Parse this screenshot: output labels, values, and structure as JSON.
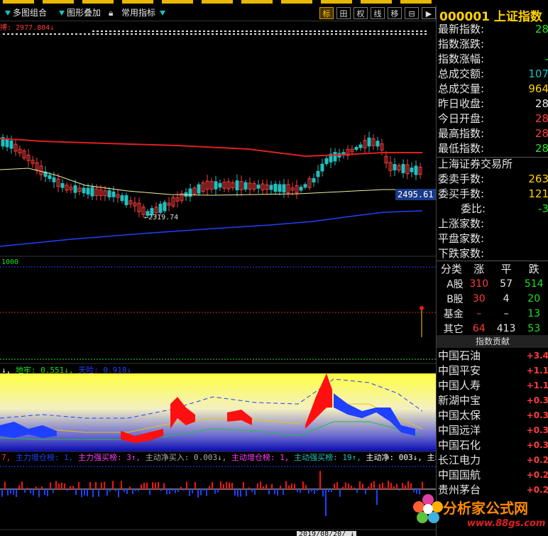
{
  "toolbar": {
    "multi_chart": "多图组合",
    "overlay": "图形叠加",
    "common_indicators": "常用指标",
    "icons": [
      {
        "label": "标",
        "name": "mark-icon",
        "active": true
      },
      {
        "label": "田",
        "name": "grid-icon",
        "active": false
      },
      {
        "label": "权",
        "name": "weight-icon",
        "active": false
      },
      {
        "label": "线",
        "name": "line-icon",
        "active": false
      },
      {
        "label": "移",
        "name": "move-icon",
        "active": false
      },
      {
        "label": "⊟",
        "name": "window-icon",
        "active": false
      },
      {
        "label": "▶",
        "name": "next-icon",
        "active": false
      }
    ]
  },
  "main_chart": {
    "top_label": "搏: 2977.804↓",
    "current_price_tag": "2495.61",
    "low_label": "←2319.74",
    "colors": {
      "ma_long": "#e02020",
      "ma_mid": "#f0f0a0",
      "ma_slow": "#2040ff",
      "up": "#ff3b3b",
      "down": "#21c0c0"
    }
  },
  "vol_panel": {
    "label": "1000"
  },
  "indicator_panel": {
    "labels": [
      {
        "text": "↓,",
        "color": "#ffffff"
      },
      {
        "text": "地牢: 0.551↓,",
        "color": "#21e021"
      },
      {
        "text": "天险: 0.918↓",
        "color": "#2040ff"
      }
    ]
  },
  "flow_panel": {
    "labels": [
      {
        "text": "7,",
        "color": "#ff3b3b"
      },
      {
        "text": "主力增仓榜: 1,",
        "color": "#2040ff"
      },
      {
        "text": "主力强买榜: 3↑,",
        "color": "#ff3bff"
      },
      {
        "text": "主动净买入: 0.003↓,",
        "color": "#aaaaaa"
      },
      {
        "text": "主动增仓榜: 1,",
        "color": "#ff3bff"
      },
      {
        "text": "主动强买榜: 19↑,",
        "color": "#21c0c0"
      },
      {
        "text": "主动净: 003↓,",
        "color": "#ffffff"
      },
      {
        "text": "主动",
        "color": "#ffffff"
      }
    ],
    "bottom_label": "2019/08/20/ ↓"
  },
  "right_panel": {
    "code": "000001",
    "name": "上证指数",
    "quote_rows": [
      {
        "label": "最新指数:",
        "value": "28",
        "color": "#21e021"
      },
      {
        "label": "指数涨跌:",
        "value": "",
        "color": "#21e021"
      },
      {
        "label": "指数涨幅:",
        "value": "-",
        "color": "#21e021"
      },
      {
        "label": "总成交额:",
        "value": "107",
        "color": "#17c3c3"
      },
      {
        "label": "总成交量:",
        "value": "964",
        "color": "#ffd200"
      },
      {
        "label": "昨日收盘:",
        "value": "28",
        "color": "#e6e6e6"
      },
      {
        "label": "今日开盘:",
        "value": "28",
        "color": "#ff3b3b"
      },
      {
        "label": "最高指数:",
        "value": "28",
        "color": "#ff3b3b"
      },
      {
        "label": "最低指数:",
        "value": "28",
        "color": "#21e021"
      }
    ],
    "exchange": "上海证券交易所",
    "order_rows": [
      {
        "label": "委卖手数:",
        "value": "263",
        "color": "#ffd200"
      },
      {
        "label": "委买手数:",
        "value": "121",
        "color": "#ffd200"
      },
      {
        "label": "委比:",
        "value": "-3",
        "color": "#21e021"
      },
      {
        "label": "上涨家数:",
        "value": "",
        "color": "#ff3b3b"
      },
      {
        "label": "平盘家数:",
        "value": "",
        "color": "#e6e6e6"
      },
      {
        "label": "下跌家数:",
        "value": "",
        "color": "#21e021"
      }
    ],
    "breadth_table": {
      "headers": [
        "分类",
        "涨",
        "平",
        "跌"
      ],
      "rows": [
        [
          "A股",
          "310",
          "57",
          "514"
        ],
        [
          "B股",
          "30",
          "4",
          "20"
        ],
        [
          "基金",
          "–",
          "–",
          "13"
        ],
        [
          "其它",
          "64",
          "413",
          "53"
        ]
      ]
    },
    "contrib_header": "指数贡献",
    "contributors": [
      {
        "name": "中国石油",
        "value": "+3.4"
      },
      {
        "name": "中国平安",
        "value": "+1.1"
      },
      {
        "name": "中国人寿",
        "value": "+1.1"
      },
      {
        "name": "新湖中宝",
        "value": "+0.3"
      },
      {
        "name": "中国太保",
        "value": "+0.3"
      },
      {
        "name": "中国远洋",
        "value": "+0.3"
      },
      {
        "name": "中国石化",
        "value": "+0.3"
      },
      {
        "name": "长江电力",
        "value": "+0.2"
      },
      {
        "name": "中国国航",
        "value": "+0.2"
      },
      {
        "name": "贵州茅台",
        "value": "+0.2"
      }
    ]
  },
  "watermark": {
    "main": "分析家公式网",
    "url": "www.88gs.com"
  }
}
